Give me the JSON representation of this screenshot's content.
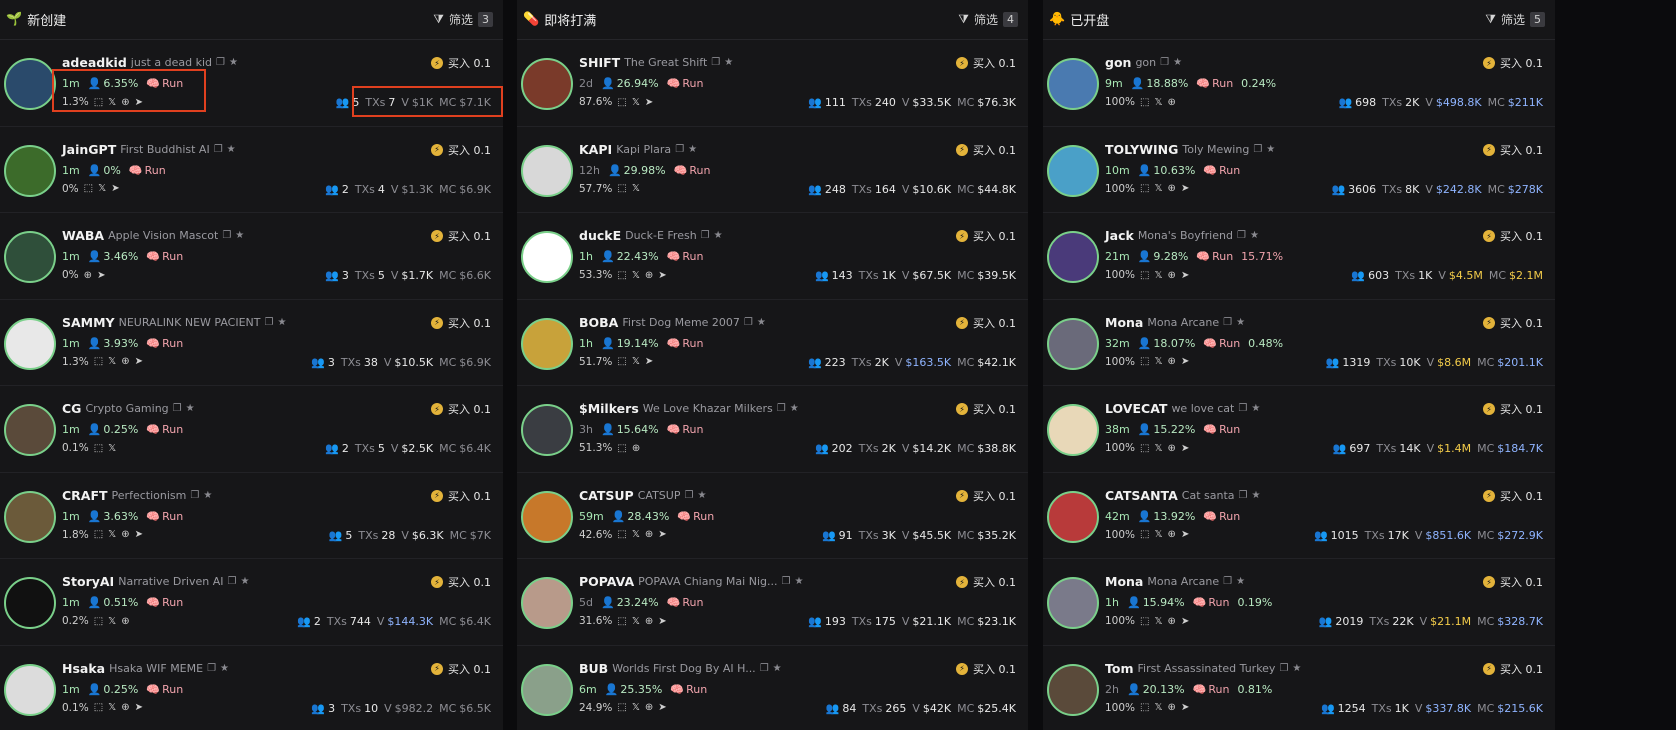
{
  "columns": [
    {
      "title": "新创建",
      "icon": "🌱",
      "filter_label": "筛选",
      "filter_count": "3",
      "tokens": [
        {
          "ticker": "adeadkid",
          "name": "just a dead kid",
          "age": "1m",
          "holder_pct": "6.35%",
          "pct3": "1.3%",
          "socials": [
            "web",
            "x",
            "globe",
            "tg"
          ],
          "holders": "5",
          "txs": "7",
          "vol": "$1K",
          "mc": "$7.1K",
          "vol_color": "muted",
          "mc_color": "muted",
          "buy": "买入 0.1",
          "avatar_bg": "#2a4a6b"
        },
        {
          "ticker": "JainGPT",
          "name": "First Buddhist AI",
          "age": "1m",
          "holder_pct": "0%",
          "pct3": "0%",
          "socials": [
            "web",
            "x",
            "tg"
          ],
          "holders": "2",
          "txs": "4",
          "vol": "$1.3K",
          "mc": "$6.9K",
          "vol_color": "muted",
          "mc_color": "muted",
          "buy": "买入 0.1",
          "avatar_bg": "#3c6b2a"
        },
        {
          "ticker": "WABA",
          "name": "Apple Vision Mascot",
          "age": "1m",
          "holder_pct": "3.46%",
          "pct3": "0%",
          "socials": [
            "globe",
            "tg"
          ],
          "holders": "3",
          "txs": "5",
          "vol": "$1.7K",
          "mc": "$6.6K",
          "vol_color": "",
          "mc_color": "muted",
          "buy": "买入 0.1",
          "avatar_bg": "#2f4f3a"
        },
        {
          "ticker": "SAMMY",
          "name": "NEURALINK NEW PACIENT",
          "age": "1m",
          "holder_pct": "3.93%",
          "pct3": "1.3%",
          "socials": [
            "web",
            "x",
            "globe",
            "tg"
          ],
          "holders": "3",
          "txs": "38",
          "vol": "$10.5K",
          "mc": "$6.9K",
          "vol_color": "",
          "mc_color": "muted",
          "buy": "买入 0.1",
          "avatar_bg": "#e8e8e8"
        },
        {
          "ticker": "CG",
          "name": "Crypto Gaming",
          "age": "1m",
          "holder_pct": "0.25%",
          "pct3": "0.1%",
          "socials": [
            "web",
            "x"
          ],
          "holders": "2",
          "txs": "5",
          "vol": "$2.5K",
          "mc": "$6.4K",
          "vol_color": "",
          "mc_color": "muted",
          "buy": "买入 0.1",
          "avatar_bg": "#5a4a3a"
        },
        {
          "ticker": "CRAFT",
          "name": "Perfectionism",
          "age": "1m",
          "holder_pct": "3.63%",
          "pct3": "1.8%",
          "socials": [
            "web",
            "x",
            "globe",
            "tg"
          ],
          "holders": "5",
          "txs": "28",
          "vol": "$6.3K",
          "mc": "$7K",
          "vol_color": "",
          "mc_color": "muted",
          "buy": "买入 0.1",
          "avatar_bg": "#6b5a3a"
        },
        {
          "ticker": "StoryAI",
          "name": "Narrative Driven AI",
          "age": "1m",
          "holder_pct": "0.51%",
          "pct3": "0.2%",
          "socials": [
            "web",
            "x",
            "globe"
          ],
          "holders": "2",
          "txs": "744",
          "vol": "$144.3K",
          "mc": "$6.4K",
          "vol_color": "blue",
          "mc_color": "muted",
          "buy": "买入 0.1",
          "avatar_bg": "#111111"
        },
        {
          "ticker": "Hsaka",
          "name": "Hsaka WIF MEME",
          "age": "1m",
          "holder_pct": "0.25%",
          "pct3": "0.1%",
          "socials": [
            "web",
            "x",
            "globe",
            "tg"
          ],
          "holders": "3",
          "txs": "10",
          "vol": "$982.2",
          "mc": "$6.5K",
          "vol_color": "muted",
          "mc_color": "muted",
          "buy": "买入 0.1",
          "avatar_bg": "#dcdcdc"
        }
      ]
    },
    {
      "title": "即将打满",
      "icon": "💊",
      "filter_label": "筛选",
      "filter_count": "4",
      "tokens": [
        {
          "ticker": "SHIFT",
          "name": "The Great Shift",
          "age": "2d",
          "age_dim": true,
          "holder_pct": "26.94%",
          "pct3": "87.6%",
          "socials": [
            "web",
            "x",
            "tg"
          ],
          "holders": "111",
          "txs": "240",
          "vol": "$33.5K",
          "mc": "$76.3K",
          "vol_color": "",
          "mc_color": "",
          "buy": "买入 0.1",
          "avatar_bg": "#7a3a2a"
        },
        {
          "ticker": "KAPI",
          "name": "Kapi Plara",
          "age": "12h",
          "age_dim": true,
          "holder_pct": "29.98%",
          "pct3": "57.7%",
          "socials": [
            "web",
            "x"
          ],
          "holders": "248",
          "txs": "164",
          "vol": "$10.6K",
          "mc": "$44.8K",
          "vol_color": "",
          "mc_color": "",
          "buy": "买入 0.1",
          "avatar_bg": "#d8d8d8"
        },
        {
          "ticker": "duckE",
          "name": "Duck-E Fresh",
          "age": "1h",
          "holder_pct": "22.43%",
          "pct3": "53.3%",
          "socials": [
            "web",
            "x",
            "globe",
            "tg"
          ],
          "holders": "143",
          "txs": "1K",
          "vol": "$67.5K",
          "mc": "$39.5K",
          "vol_color": "",
          "mc_color": "",
          "buy": "买入 0.1",
          "avatar_bg": "#ffffff"
        },
        {
          "ticker": "BOBA",
          "name": "First Dog Meme 2007",
          "age": "1h",
          "holder_pct": "19.14%",
          "pct3": "51.7%",
          "socials": [
            "web",
            "x",
            "tg"
          ],
          "holders": "223",
          "txs": "2K",
          "vol": "$163.5K",
          "mc": "$42.1K",
          "vol_color": "blue",
          "mc_color": "",
          "buy": "买入 0.1",
          "avatar_bg": "#c8a23a"
        },
        {
          "ticker": "$Milkers",
          "name": "We Love Khazar Milkers",
          "age": "3h",
          "age_dim": true,
          "holder_pct": "15.64%",
          "pct3": "51.3%",
          "socials": [
            "web",
            "globe"
          ],
          "holders": "202",
          "txs": "2K",
          "vol": "$14.2K",
          "mc": "$38.8K",
          "vol_color": "",
          "mc_color": "",
          "buy": "买入 0.1",
          "avatar_bg": "#3a3d42"
        },
        {
          "ticker": "CATSUP",
          "name": "CATSUP",
          "age": "59m",
          "holder_pct": "28.43%",
          "pct3": "42.6%",
          "socials": [
            "web",
            "x",
            "globe",
            "tg"
          ],
          "holders": "91",
          "txs": "3K",
          "vol": "$45.5K",
          "mc": "$35.2K",
          "vol_color": "",
          "mc_color": "",
          "buy": "买入 0.1",
          "avatar_bg": "#c7782a"
        },
        {
          "ticker": "POPAVA",
          "name": "POPAVA Chiang Mai Nig...",
          "age": "5d",
          "age_dim": true,
          "holder_pct": "23.24%",
          "pct3": "31.6%",
          "socials": [
            "web",
            "x",
            "globe",
            "tg"
          ],
          "holders": "193",
          "txs": "175",
          "vol": "$21.1K",
          "mc": "$23.1K",
          "vol_color": "",
          "mc_color": "",
          "buy": "买入 0.1",
          "avatar_bg": "#b89a8a"
        },
        {
          "ticker": "BUB",
          "name": "Worlds First Dog By AI H...",
          "age": "6m",
          "holder_pct": "25.35%",
          "pct3": "24.9%",
          "socials": [
            "web",
            "x",
            "globe",
            "tg"
          ],
          "holders": "84",
          "txs": "265",
          "vol": "$42K",
          "mc": "$25.4K",
          "vol_color": "",
          "mc_color": "",
          "buy": "买入 0.1",
          "avatar_bg": "#8aa08a"
        }
      ]
    },
    {
      "title": "已开盘",
      "icon": "🐥",
      "filter_label": "筛选",
      "filter_count": "5",
      "tokens": [
        {
          "ticker": "gon",
          "name": "gon",
          "age": "9m",
          "holder_pct": "18.88%",
          "extra": "0.24%",
          "extra_color": "g",
          "pct3": "100%",
          "socials": [
            "web",
            "x",
            "globe"
          ],
          "holders": "698",
          "txs": "2K",
          "vol": "$498.8K",
          "mc": "$211K",
          "vol_color": "blue",
          "mc_color": "blue",
          "buy": "买入 0.1",
          "avatar_bg": "#4a7ab0"
        },
        {
          "ticker": "TOLYWING",
          "name": "Toly Mewing",
          "age": "10m",
          "holder_pct": "10.63%",
          "pct3": "100%",
          "socials": [
            "web",
            "x",
            "globe",
            "tg"
          ],
          "holders": "3606",
          "txs": "8K",
          "vol": "$242.8K",
          "mc": "$278K",
          "vol_color": "blue",
          "mc_color": "blue",
          "buy": "买入 0.1",
          "avatar_bg": "#4aa0c8"
        },
        {
          "ticker": "Jack",
          "name": "Mona's Boyfriend",
          "age": "21m",
          "holder_pct": "9.28%",
          "extra": "15.71%",
          "extra_color": "r",
          "pct3": "100%",
          "socials": [
            "web",
            "x",
            "globe",
            "tg"
          ],
          "holders": "603",
          "txs": "1K",
          "vol": "$4.5M",
          "mc": "$2.1M",
          "vol_color": "yellow",
          "mc_color": "yellow",
          "buy": "买入 0.1",
          "avatar_bg": "#4a3a7a"
        },
        {
          "ticker": "Mona",
          "name": "Mona Arcane",
          "age": "32m",
          "holder_pct": "18.07%",
          "extra": "0.48%",
          "extra_color": "g",
          "pct3": "100%",
          "socials": [
            "web",
            "x",
            "globe",
            "tg"
          ],
          "holders": "1319",
          "txs": "10K",
          "vol": "$8.6M",
          "mc": "$201.1K",
          "vol_color": "yellow",
          "mc_color": "blue",
          "buy": "买入 0.1",
          "avatar_bg": "#6a6a7a"
        },
        {
          "ticker": "LOVECAT",
          "name": "we love cat",
          "age": "38m",
          "holder_pct": "15.22%",
          "pct3": "100%",
          "socials": [
            "web",
            "x",
            "globe",
            "tg"
          ],
          "holders": "697",
          "txs": "14K",
          "vol": "$1.4M",
          "mc": "$184.7K",
          "vol_color": "yellow",
          "mc_color": "blue",
          "buy": "买入 0.1",
          "avatar_bg": "#e8d8b8"
        },
        {
          "ticker": "CATSANTA",
          "name": "Cat santa",
          "age": "42m",
          "holder_pct": "13.92%",
          "pct3": "100%",
          "socials": [
            "web",
            "x",
            "globe",
            "tg"
          ],
          "holders": "1015",
          "txs": "17K",
          "vol": "$851.6K",
          "mc": "$272.9K",
          "vol_color": "blue",
          "mc_color": "blue",
          "buy": "买入 0.1",
          "avatar_bg": "#b83a3a"
        },
        {
          "ticker": "Mona",
          "name": "Mona Arcane",
          "age": "1h",
          "holder_pct": "15.94%",
          "extra": "0.19%",
          "extra_color": "g",
          "pct3": "100%",
          "socials": [
            "web",
            "x",
            "globe",
            "tg"
          ],
          "holders": "2019",
          "txs": "22K",
          "vol": "$21.1M",
          "mc": "$328.7K",
          "vol_color": "yellow",
          "mc_color": "blue",
          "buy": "买入 0.1",
          "avatar_bg": "#7a7a8a"
        },
        {
          "ticker": "Tom",
          "name": "First Assassinated Turkey",
          "age": "2h",
          "age_dim": true,
          "holder_pct": "20.13%",
          "extra": "0.81%",
          "extra_color": "g",
          "pct3": "100%",
          "socials": [
            "web",
            "x",
            "globe",
            "tg"
          ],
          "holders": "1254",
          "txs": "1K",
          "vol": "$337.8K",
          "mc": "$215.6K",
          "vol_color": "blue",
          "mc_color": "blue",
          "buy": "买入 0.1",
          "avatar_bg": "#5a4a3a"
        }
      ]
    }
  ],
  "labels": {
    "run": "Run",
    "txs": "TXs",
    "vol": "V",
    "mc": "MC"
  }
}
